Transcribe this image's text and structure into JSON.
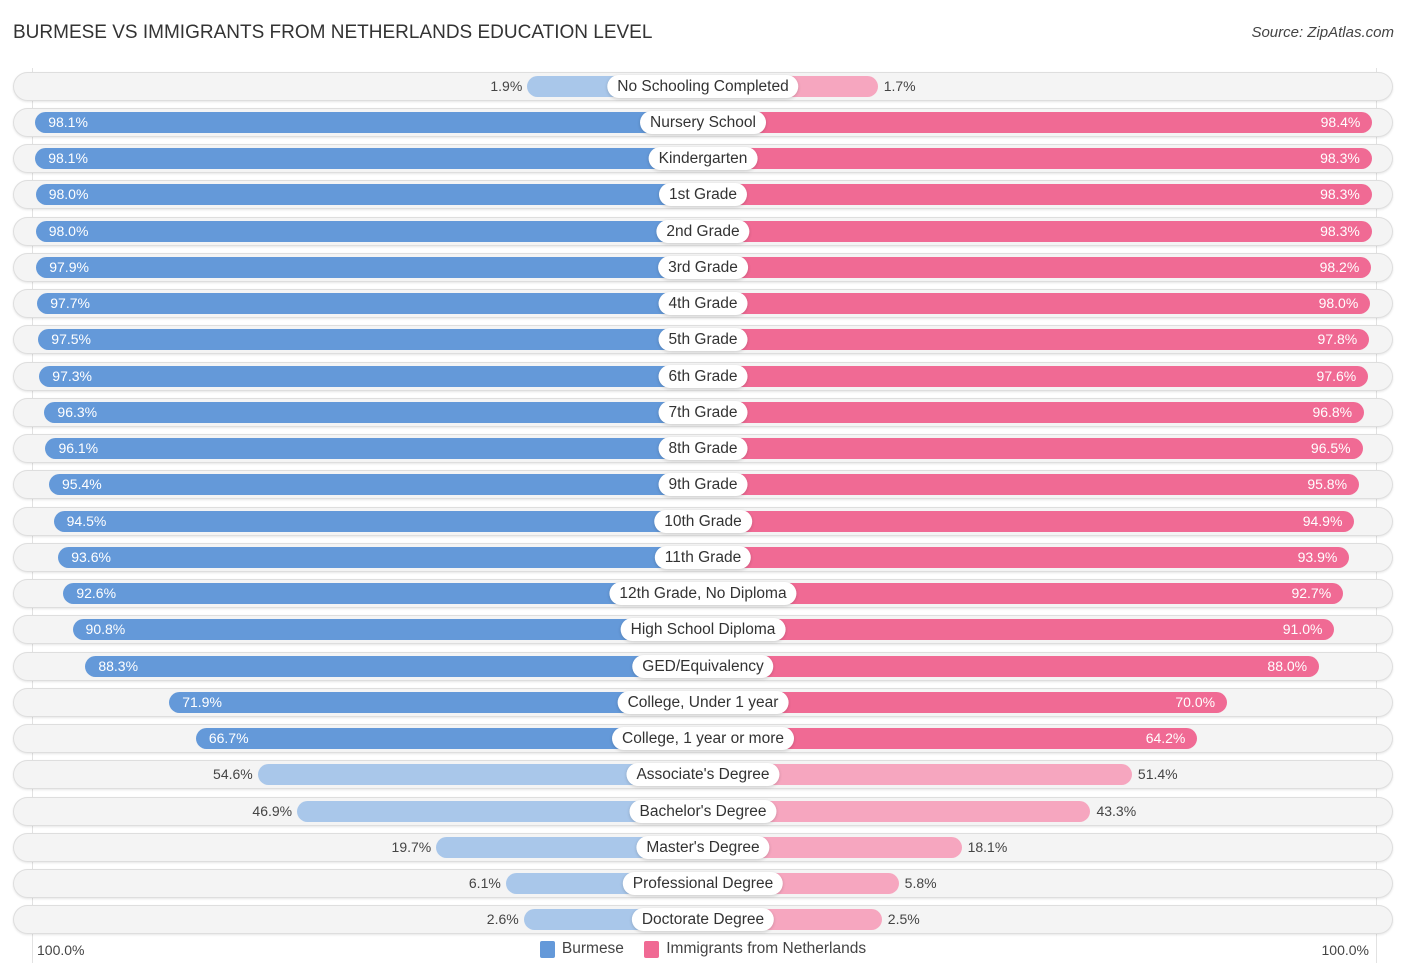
{
  "header": {
    "title": "BURMESE VS IMMIGRANTS FROM NETHERLANDS EDUCATION LEVEL",
    "source": "Source: ZipAtlas.com"
  },
  "colors": {
    "burmese_strong": "#6499d9",
    "burmese_light": "#a9c7ea",
    "netherlands_strong": "#f06a94",
    "netherlands_light": "#f6a6bf"
  },
  "chart_data": {
    "type": "bar",
    "orientation": "horizontal-diverging",
    "title": "BURMESE VS IMMIGRANTS FROM NETHERLANDS EDUCATION LEVEL",
    "xlabel": "",
    "ylabel": "",
    "axis_left_label": "100.0%",
    "axis_right_label": "100.0%",
    "xlim": [
      0,
      100
    ],
    "legend_position": "bottom-center",
    "categories": [
      "No Schooling Completed",
      "Nursery School",
      "Kindergarten",
      "1st Grade",
      "2nd Grade",
      "3rd Grade",
      "4th Grade",
      "5th Grade",
      "6th Grade",
      "7th Grade",
      "8th Grade",
      "9th Grade",
      "10th Grade",
      "11th Grade",
      "12th Grade, No Diploma",
      "High School Diploma",
      "GED/Equivalency",
      "College, Under 1 year",
      "College, 1 year or more",
      "Associate's Degree",
      "Bachelor's Degree",
      "Master's Degree",
      "Professional Degree",
      "Doctorate Degree"
    ],
    "series": [
      {
        "name": "Burmese",
        "values": [
          1.9,
          98.1,
          98.1,
          98.0,
          98.0,
          97.9,
          97.7,
          97.5,
          97.3,
          96.3,
          96.1,
          95.4,
          94.5,
          93.6,
          92.6,
          90.8,
          88.3,
          71.9,
          66.7,
          54.6,
          46.9,
          19.7,
          6.1,
          2.6
        ],
        "labels": [
          "1.9%",
          "98.1%",
          "98.1%",
          "98.0%",
          "98.0%",
          "97.9%",
          "97.7%",
          "97.5%",
          "97.3%",
          "96.3%",
          "96.1%",
          "95.4%",
          "94.5%",
          "93.6%",
          "92.6%",
          "90.8%",
          "88.3%",
          "71.9%",
          "66.7%",
          "54.6%",
          "46.9%",
          "19.7%",
          "6.1%",
          "2.6%"
        ]
      },
      {
        "name": "Immigrants from Netherlands",
        "values": [
          1.7,
          98.4,
          98.3,
          98.3,
          98.3,
          98.2,
          98.0,
          97.8,
          97.6,
          96.8,
          96.5,
          95.8,
          94.9,
          93.9,
          92.7,
          91.0,
          88.0,
          70.0,
          64.2,
          51.4,
          43.3,
          18.1,
          5.8,
          2.5
        ],
        "labels": [
          "1.7%",
          "98.4%",
          "98.3%",
          "98.3%",
          "98.3%",
          "98.2%",
          "98.0%",
          "97.8%",
          "97.6%",
          "96.8%",
          "96.5%",
          "95.8%",
          "94.9%",
          "93.9%",
          "92.7%",
          "91.0%",
          "88.0%",
          "70.0%",
          "64.2%",
          "51.4%",
          "43.3%",
          "18.1%",
          "5.8%",
          "2.5%"
        ]
      }
    ]
  },
  "legend": {
    "items": [
      {
        "label": "Burmese"
      },
      {
        "label": "Immigrants from Netherlands"
      }
    ]
  }
}
